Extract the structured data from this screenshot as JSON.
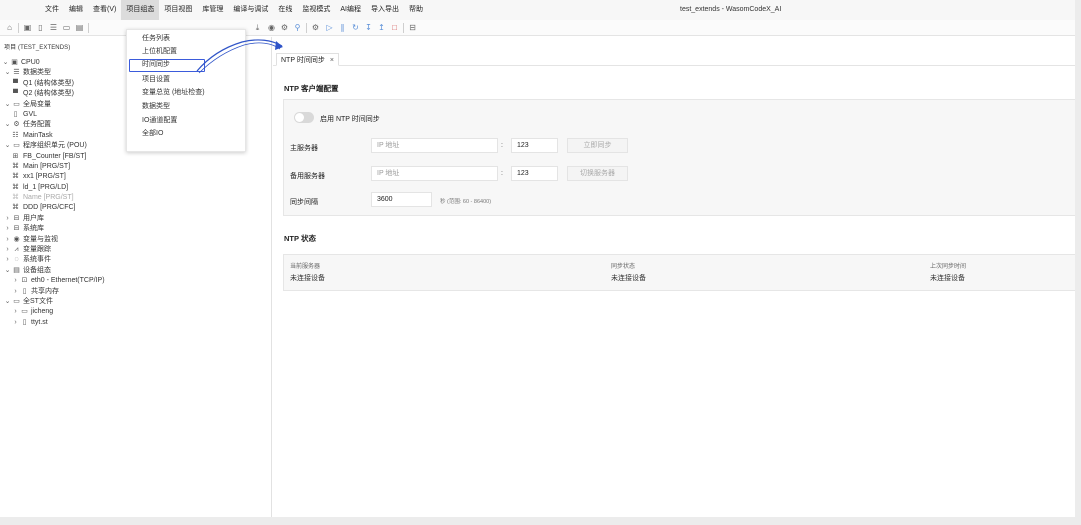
{
  "window_title": "test_extends - WasomCodeX_AI",
  "menu": {
    "items": [
      "文件",
      "编辑",
      "查看(V)",
      "项目组态",
      "项目视图",
      "库管理",
      "编译与调试",
      "在线",
      "监视模式",
      "AI编程",
      "导入导出",
      "帮助"
    ],
    "active_index": 3
  },
  "sidebar": {
    "header": "项目 (TEST_EXTENDS)",
    "tree": [
      {
        "label": "CPU0",
        "level": 0,
        "chev": "down",
        "icon": "cpu-icon"
      },
      {
        "label": "数据类型",
        "level": 1,
        "chev": "down",
        "icon": "list-icon"
      },
      {
        "label": "Q1 (结构体类型)",
        "level": 2,
        "chev": "",
        "icon": "struct-icon"
      },
      {
        "label": "Q2 (结构体类型)",
        "level": 2,
        "chev": "",
        "icon": "struct-icon"
      },
      {
        "label": "全局变量",
        "level": 1,
        "chev": "down",
        "icon": "folder-icon"
      },
      {
        "label": "GVL",
        "level": 2,
        "chev": "",
        "icon": "file-icon"
      },
      {
        "label": "任务配置",
        "level": 1,
        "chev": "down",
        "icon": "gear-icon"
      },
      {
        "label": "MainTask",
        "level": 2,
        "chev": "",
        "icon": "task-icon"
      },
      {
        "label": "程序组织单元 (POU)",
        "level": 1,
        "chev": "down",
        "icon": "folder-icon"
      },
      {
        "label": "FB_Counter [FB/ST]",
        "level": 2,
        "chev": "",
        "icon": "fb-icon"
      },
      {
        "label": "Main [PRG/ST]",
        "level": 2,
        "chev": "",
        "icon": "prg-icon"
      },
      {
        "label": "xx1 [PRG/ST]",
        "level": 2,
        "chev": "",
        "icon": "prg-icon"
      },
      {
        "label": "ld_1 [PRG/LD]",
        "level": 2,
        "chev": "",
        "icon": "prg-icon"
      },
      {
        "label": "Name [PRG/ST]",
        "level": 2,
        "chev": "",
        "icon": "prg-icon",
        "dim": true
      },
      {
        "label": "DDD [PRG/CFC]",
        "level": 2,
        "chev": "",
        "icon": "prg-icon"
      },
      {
        "label": "用户库",
        "level": 1,
        "chev": "right",
        "icon": "library-icon"
      },
      {
        "label": "系统库",
        "level": 1,
        "chev": "right",
        "icon": "library-icon"
      },
      {
        "label": "变量与监视",
        "level": 1,
        "chev": "right",
        "icon": "eye-icon"
      },
      {
        "label": "变量跟踪",
        "level": 1,
        "chev": "right",
        "icon": "trend-icon"
      },
      {
        "label": "系统事件",
        "level": 1,
        "chev": "right",
        "icon": "bell-icon"
      },
      {
        "label": "设备组态",
        "level": 1,
        "chev": "down",
        "icon": "device-icon"
      },
      {
        "label": "eth0 - Ethernet(TCP/IP)",
        "level": 2,
        "chev": "right",
        "icon": "ethernet-icon"
      },
      {
        "label": "共享内存",
        "level": 2,
        "chev": "right",
        "icon": "memory-icon"
      },
      {
        "label": "全ST文件",
        "level": 1,
        "chev": "down",
        "icon": "folder-icon"
      },
      {
        "label": "jicheng",
        "level": 2,
        "chev": "right",
        "icon": "folder-icon"
      },
      {
        "label": "ttyt.st",
        "level": 2,
        "chev": "right",
        "icon": "file-icon"
      }
    ]
  },
  "dropdown": {
    "items": [
      "任务列表",
      "上位机配置",
      "时间同步",
      "项目设置",
      "变量总览 (地址检查)",
      "数据类型",
      "IO通道配置",
      "全部IO"
    ],
    "highlighted_index": 2
  },
  "tab": {
    "label": "NTP 时间同步",
    "close": "×"
  },
  "ntp_client": {
    "title": "NTP 客户端配置",
    "enable_label": "启用 NTP 时间同步",
    "enabled": false,
    "primary_label": "主服务器",
    "primary_placeholder": "IP 地址",
    "primary_port": "123",
    "sync_now_label": "立即同步",
    "backup_label": "备用服务器",
    "backup_placeholder": "IP 地址",
    "backup_port": "123",
    "switch_label": "切换服务器",
    "interval_label": "同步间隔",
    "interval_value": "3600",
    "interval_hint": "秒 (范围: 60 - 86400)",
    "colon": ":"
  },
  "ntp_status": {
    "title": "NTP 状态",
    "columns": [
      {
        "head": "当前服务器",
        "value": "未连接设备"
      },
      {
        "head": "同步状态",
        "value": "未连接设备"
      },
      {
        "head": "上次同步时间",
        "value": "未连接设备"
      }
    ]
  },
  "colors": {
    "highlight": "#3b5bdb",
    "arrow": "#2f54c8"
  },
  "toolbar_icons": [
    "home-icon",
    "new-icon",
    "save-icon",
    "list-icon",
    "folder-icon",
    "save-as-icon",
    "download-icon",
    "monitor-icon",
    "settings-icon",
    "search-icon",
    "build-icon",
    "run-icon",
    "pause-icon",
    "step-over-icon",
    "step-into-icon",
    "step-out-icon",
    "stop-icon",
    "toolbox-icon"
  ]
}
